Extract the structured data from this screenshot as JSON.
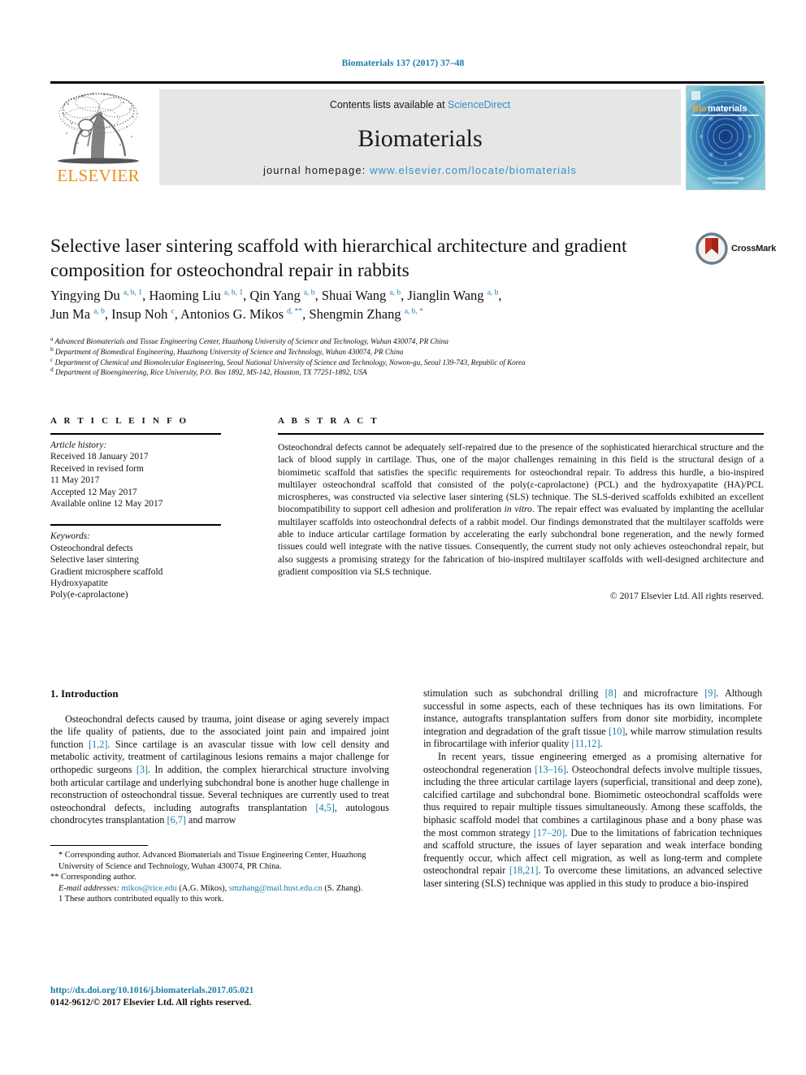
{
  "running_head": "Biomaterials 137 (2017) 37–48",
  "masthead": {
    "contents_prefix": "Contents lists available at ",
    "sciencedirect": "ScienceDirect",
    "journal_name": "Biomaterials",
    "homepage_prefix": "journal homepage: ",
    "homepage_url": "www.elsevier.com/locate/biomaterials",
    "publisher": "ELSEVIER",
    "cover_title_a": "Bio",
    "cover_title_b": "materials",
    "accent_link": "#3a8fc4",
    "accent_orange": "#ea8f1e",
    "box_bg": "#e6e6e6"
  },
  "article": {
    "title": "Selective laser sintering scaffold with hierarchical architecture and gradient composition for osteochondral repair in rabbits",
    "crossmark_label": "CrossMark",
    "authors_line1": "Yingying Du <sup>a, b, 1</sup>, Haoming Liu <sup>a, b, 1</sup>, Qin Yang <sup>a, b</sup>, Shuai Wang <sup>a, b</sup>, Jianglin Wang <sup>a, b</sup>,",
    "authors_line2": "Jun Ma <sup>a, b</sup>, Insup Noh <sup>c</sup>, Antonios G. Mikos <sup>d, **</sup>, Shengmin Zhang <sup>a, b, *</sup>",
    "affiliations": [
      {
        "marker": "a",
        "text": "Advanced Biomaterials and Tissue Engineering Center, Huazhong University of Science and Technology, Wuhan 430074, PR China"
      },
      {
        "marker": "b",
        "text": "Department of Biomedical Engineering, Huazhong University of Science and Technology, Wuhan 430074, PR China"
      },
      {
        "marker": "c",
        "text": "Department of Chemical and Biomolecular Engineering, Seoul National University of Science and Technology, Nowon-gu, Seoul 139-743, Republic of Korea"
      },
      {
        "marker": "d",
        "text": "Department of Bioengineering, Rice University, P.O. Box 1892, MS-142, Houston, TX 77251-1892, USA"
      }
    ]
  },
  "article_info": {
    "heading": "A R T I C L E  I N F O",
    "history_label": "Article history:",
    "history": [
      "Received 18 January 2017",
      "Received in revised form",
      "11 May 2017",
      "Accepted 12 May 2017",
      "Available online 12 May 2017"
    ],
    "keywords_label": "Keywords:",
    "keywords": [
      "Osteochondral defects",
      "Selective laser sintering",
      "Gradient microsphere scaffold",
      "Hydroxyapatite",
      "Poly(e-caprolactone)"
    ]
  },
  "abstract": {
    "heading": "A B S T R A C T",
    "text": "Osteochondral defects cannot be adequately self-repaired due to the presence of the sophisticated hierarchical structure and the lack of blood supply in cartilage. Thus, one of the major challenges remaining in this field is the structural design of a biomimetic scaffold that satisfies the specific requirements for osteochondral repair. To address this hurdle, a bio-inspired multilayer osteochondral scaffold that consisted of the poly(ε-caprolactone) (PCL) and the hydroxyapatite (HA)/PCL microspheres, was constructed via selective laser sintering (SLS) technique. The SLS-derived scaffolds exhibited an excellent biocompatibility to support cell adhesion and proliferation in vitro. The repair effect was evaluated by implanting the acellular multilayer scaffolds into osteochondral defects of a rabbit model. Our findings demonstrated that the multilayer scaffolds were able to induce articular cartilage formation by accelerating the early subchondral bone regeneration, and the newly formed tissues could well integrate with the native tissues. Consequently, the current study not only achieves osteochondral repair, but also suggests a promising strategy for the fabrication of bio-inspired multilayer scaffolds with well-designed architecture and gradient composition via SLS technique.",
    "copyright": "© 2017 Elsevier Ltd. All rights reserved."
  },
  "body": {
    "section_heading": "1. Introduction",
    "left_paragraph": "Osteochondral defects caused by trauma, joint disease or aging severely impact the life quality of patients, due to the associated joint pain and impaired joint function [1,2]. Since cartilage is an avascular tissue with low cell density and metabolic activity, treatment of cartilaginous lesions remains a major challenge for orthopedic surgeons [3]. In addition, the complex hierarchical structure involving both articular cartilage and underlying subchondral bone is another huge challenge in reconstruction of osteochondral tissue. Several techniques are currently used to treat osteochondral defects, including autografts transplantation [4,5], autologous chondrocytes transplantation [6,7] and marrow",
    "right_paragraph_1": "stimulation such as subchondral drilling [8] and microfracture [9]. Although successful in some aspects, each of these techniques has its own limitations. For instance, autografts transplantation suffers from donor site morbidity, incomplete integration and degradation of the graft tissue [10], while marrow stimulation results in fibrocartilage with inferior quality [11,12].",
    "right_paragraph_2": "In recent years, tissue engineering emerged as a promising alternative for osteochondral regeneration [13–16]. Osteochondral defects involve multiple tissues, including the three articular cartilage layers (superficial, transitional and deep zone), calcified cartilage and subchondral bone. Biomimetic osteochondral scaffolds were thus required to repair multiple tissues simultaneously. Among these scaffolds, the biphasic scaffold model that combines a cartilaginous phase and a bony phase was the most common strategy [17–20]. Due to the limitations of fabrication techniques and scaffold structure, the issues of layer separation and weak interface bonding frequently occur, which affect cell migration, as well as long-term and complete osteochondral repair [18,21]. To overcome these limitations, an advanced selective laser sintering (SLS) technique was applied in this study to produce a bio-inspired"
  },
  "footnotes": {
    "corresponding_1": "* Corresponding author. Advanced Biomaterials and Tissue Engineering Center, Huazhong University of Science and Technology, Wuhan 430074, PR China.",
    "corresponding_2": "** Corresponding author.",
    "email_label": "E-mail addresses:",
    "email_1": "mikos@rice.edu",
    "email_1_owner": "(A.G. Mikos),",
    "email_2": "smzhang@mail.hust.edu.cn",
    "email_2_owner": "(S. Zhang).",
    "equal_contrib": "1   These authors contributed equally to this work."
  },
  "doi": {
    "url": "http://dx.doi.org/10.1016/j.biomaterials.2017.05.021",
    "issn_line": "0142-9612/© 2017 Elsevier Ltd. All rights reserved."
  }
}
